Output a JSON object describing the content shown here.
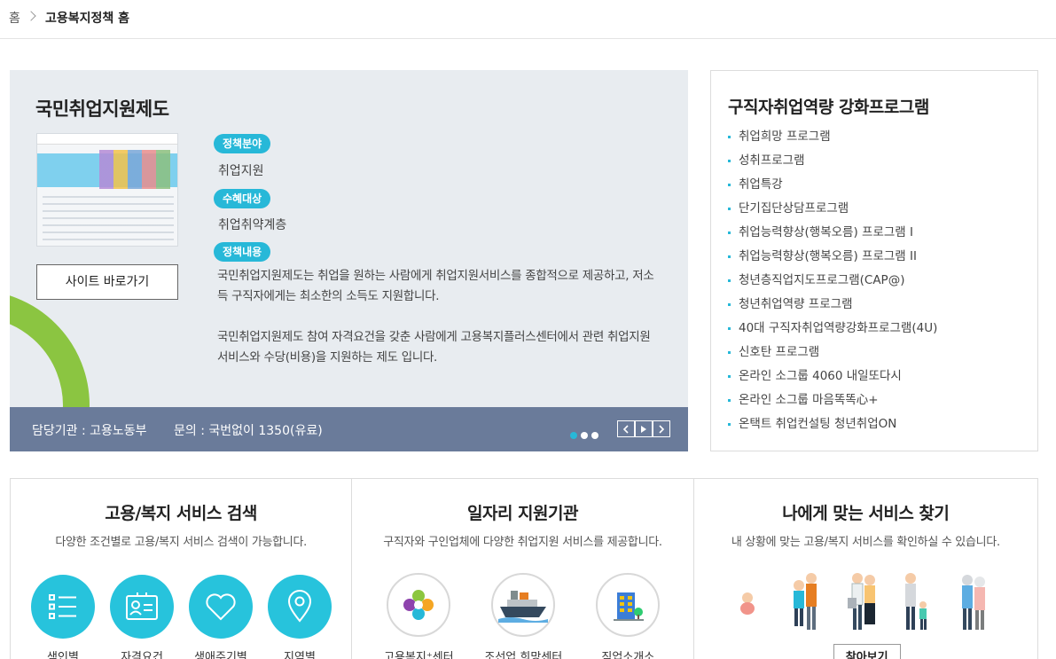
{
  "breadcrumb": {
    "home": "홈",
    "current": "고용복지정책 홈"
  },
  "feature": {
    "title": "국민취업지원제도",
    "site_button": "사이트 바로가기",
    "field_tag": "정책분야",
    "field_value": "취업지원",
    "target_tag": "수혜대상",
    "target_value": "취업취약계층",
    "content_tag": "정책내용",
    "desc1": "국민취업지원제도는 취업을 원하는 사람에게 취업지원서비스를 종합적으로 제공하고, 저소득 구직자에게는 최소한의 소득도 지원합니다.",
    "desc2": "국민취업지원제도 참여 자격요건을 갖춘 사람에게 고용복지플러스센터에서 관련 취업지원서비스와 수당(비용)을 지원하는 제도 입니다.",
    "footer": {
      "agency": "담당기관 : 고용노동부",
      "contact": "문의 : 국번없이 1350(유료)"
    }
  },
  "program_list": {
    "title": "구직자취업역량 강화프로그램",
    "items": [
      "취업희망 프로그램",
      "성취프로그램",
      "취업특강",
      "단기집단상담프로그램",
      "취업능력향상(행복오름) 프로그램 I",
      "취업능력향상(행복오름) 프로그램 II",
      "청년층직업지도프로그램(CAP@)",
      "청년취업역량 프로그램",
      "40대 구직자취업역량강화프로그램(4U)",
      "신호탄 프로그램",
      "온라인 소그룹 4060 내일또다시",
      "온라인 소그룹 마음똑똑心+",
      "온택트 취업컨설팅 청년취업ON"
    ]
  },
  "panels": {
    "search": {
      "title": "고용/복지 서비스 검색",
      "subtitle": "다양한 조건별로 고용/복지 서비스 검색이 가능합니다.",
      "items": [
        "색인별",
        "자격요건",
        "생애주기별",
        "지역별"
      ]
    },
    "agencies": {
      "title": "일자리 지원기관",
      "subtitle": "구직자와 구인업체에 다양한 취업지원 서비스를 제공합니다.",
      "items": [
        "고용복지⁺센터",
        "조선업 희망센터",
        "직업소개소"
      ]
    },
    "finder": {
      "title": "나에게 맞는 서비스 찾기",
      "subtitle": "내 상황에 맞는 고용/복지 서비스를 확인하실 수 있습니다.",
      "button": "찾아보기"
    }
  },
  "colors": {
    "accent": "#27b8d8",
    "footer_bar": "#6a7b9a",
    "arc": "#8bc541",
    "feature_bg": "#e8ecf0"
  }
}
